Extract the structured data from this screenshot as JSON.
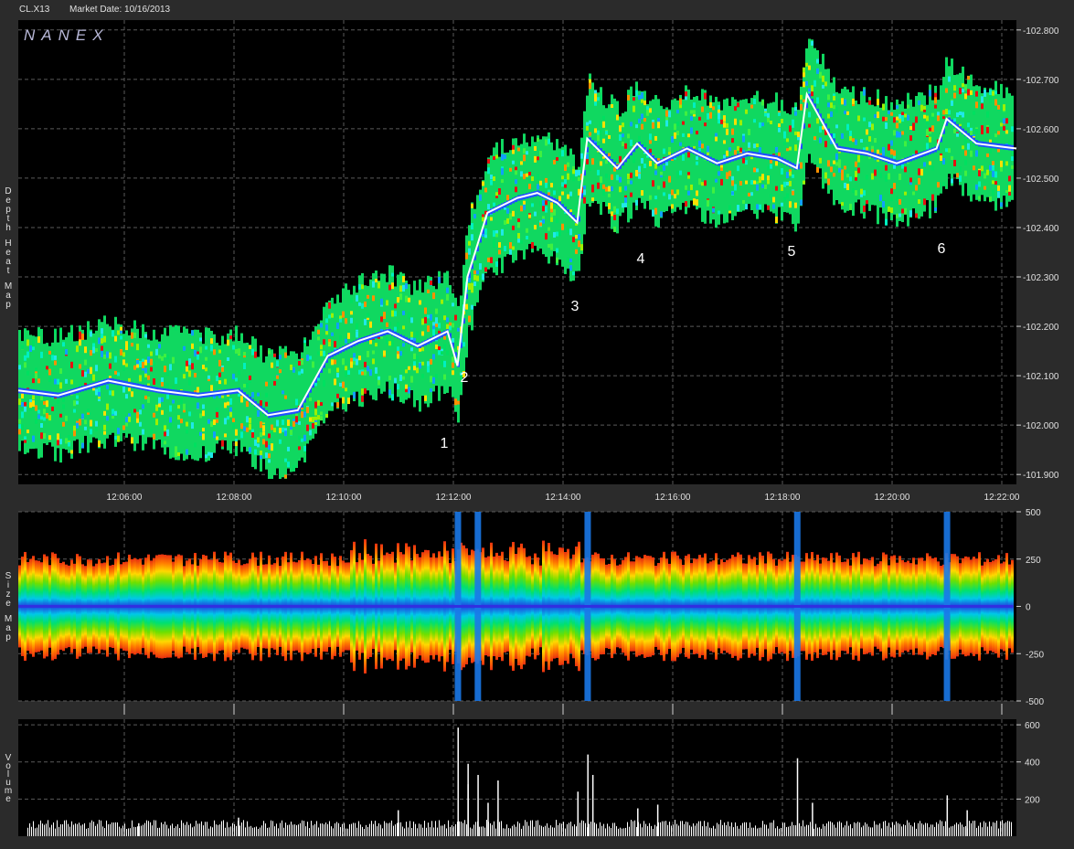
{
  "header": {
    "symbol": "CL.X13",
    "market_date": "Market Date: 10/16/2013"
  },
  "watermark": "NANEX",
  "colors": {
    "background": "#000000",
    "frame": "#2b2b2b",
    "grid": "#5a5a5a",
    "text": "#e0e0e0",
    "price_trail": "#ffffff"
  },
  "chart_data": [
    {
      "type": "heatmap",
      "panel": "depth",
      "ylabel": "Depth Heat Map",
      "x_ticks": [
        "12:06:00",
        "12:08:00",
        "12:10:00",
        "12:12:00",
        "12:14:00",
        "12:16:00",
        "12:18:00",
        "12:20:00",
        "12:22:00"
      ],
      "y_ticks": [
        "102.800",
        "102.700",
        "102.600",
        "102.500",
        "102.400",
        "102.300",
        "102.200",
        "102.100",
        "102.000",
        "101.900"
      ],
      "ylim": [
        101.88,
        102.82
      ],
      "grid": true,
      "annotations": [
        "1",
        "2",
        "3",
        "4",
        "5",
        "6"
      ],
      "price_trail": [
        {
          "t": 0,
          "p": 102.07
        },
        {
          "t": 0.04,
          "p": 102.06
        },
        {
          "t": 0.09,
          "p": 102.09
        },
        {
          "t": 0.14,
          "p": 102.07
        },
        {
          "t": 0.18,
          "p": 102.06
        },
        {
          "t": 0.22,
          "p": 102.07
        },
        {
          "t": 0.25,
          "p": 102.02
        },
        {
          "t": 0.28,
          "p": 102.03
        },
        {
          "t": 0.31,
          "p": 102.14
        },
        {
          "t": 0.34,
          "p": 102.17
        },
        {
          "t": 0.37,
          "p": 102.19
        },
        {
          "t": 0.4,
          "p": 102.16
        },
        {
          "t": 0.43,
          "p": 102.19
        },
        {
          "t": 0.44,
          "p": 102.12
        },
        {
          "t": 0.45,
          "p": 102.3
        },
        {
          "t": 0.47,
          "p": 102.43
        },
        {
          "t": 0.5,
          "p": 102.46
        },
        {
          "t": 0.52,
          "p": 102.47
        },
        {
          "t": 0.54,
          "p": 102.45
        },
        {
          "t": 0.56,
          "p": 102.41
        },
        {
          "t": 0.57,
          "p": 102.58
        },
        {
          "t": 0.6,
          "p": 102.52
        },
        {
          "t": 0.62,
          "p": 102.57
        },
        {
          "t": 0.64,
          "p": 102.53
        },
        {
          "t": 0.67,
          "p": 102.56
        },
        {
          "t": 0.7,
          "p": 102.53
        },
        {
          "t": 0.73,
          "p": 102.55
        },
        {
          "t": 0.76,
          "p": 102.54
        },
        {
          "t": 0.78,
          "p": 102.52
        },
        {
          "t": 0.79,
          "p": 102.67
        },
        {
          "t": 0.82,
          "p": 102.56
        },
        {
          "t": 0.85,
          "p": 102.55
        },
        {
          "t": 0.88,
          "p": 102.53
        },
        {
          "t": 0.92,
          "p": 102.56
        },
        {
          "t": 0.93,
          "p": 102.62
        },
        {
          "t": 0.96,
          "p": 102.57
        },
        {
          "t": 1.0,
          "p": 102.56
        }
      ]
    },
    {
      "type": "heatmap",
      "panel": "size",
      "ylabel": "Size Map",
      "y_ticks": [
        "500",
        "250",
        "0",
        "-250",
        "-500"
      ],
      "ylim": [
        -500,
        500
      ],
      "spike_times": [
        0.44,
        0.46,
        0.57,
        0.78,
        0.93
      ]
    },
    {
      "type": "bar",
      "panel": "volume",
      "ylabel": "Volume",
      "y_ticks": [
        "600",
        "400",
        "200"
      ],
      "ylim": [
        0,
        630
      ],
      "spikes": [
        {
          "t": 0.44,
          "v": 585
        },
        {
          "t": 0.45,
          "v": 390
        },
        {
          "t": 0.46,
          "v": 330
        },
        {
          "t": 0.45,
          "v": 280
        },
        {
          "t": 0.48,
          "v": 300
        },
        {
          "t": 0.47,
          "v": 180
        },
        {
          "t": 0.57,
          "v": 440
        },
        {
          "t": 0.575,
          "v": 330
        },
        {
          "t": 0.56,
          "v": 240
        },
        {
          "t": 0.62,
          "v": 150
        },
        {
          "t": 0.64,
          "v": 170
        },
        {
          "t": 0.78,
          "v": 420
        },
        {
          "t": 0.795,
          "v": 180
        },
        {
          "t": 0.93,
          "v": 220
        },
        {
          "t": 0.95,
          "v": 140
        },
        {
          "t": 0.22,
          "v": 100
        },
        {
          "t": 0.38,
          "v": 140
        },
        {
          "t": 0.12,
          "v": 70
        }
      ]
    }
  ]
}
